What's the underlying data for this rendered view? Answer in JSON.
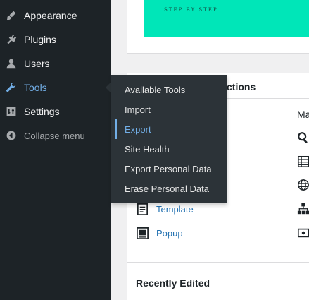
{
  "sidebar": {
    "items": [
      {
        "label": "Appearance",
        "icon": "paintbrush-icon"
      },
      {
        "label": "Plugins",
        "icon": "plugin-icon"
      },
      {
        "label": "Users",
        "icon": "user-icon"
      },
      {
        "label": "Tools",
        "icon": "wrench-icon"
      },
      {
        "label": "Settings",
        "icon": "settings-icon"
      }
    ],
    "collapse_label": "Collapse menu"
  },
  "tools_flyout": {
    "items": [
      "Available Tools",
      "Import",
      "Export",
      "Site Health",
      "Export Personal Data",
      "Erase Personal Data"
    ],
    "current": "Export"
  },
  "content": {
    "banner_text": "STEP BY STEP",
    "section_title_visible": "ctions",
    "right_column_label": "Ma",
    "links": [
      "Template",
      "Popup"
    ],
    "recently_edited_title": "Recently Edited"
  },
  "colors": {
    "sidebar_bg": "#1d2327",
    "flyout_bg": "#2c3338",
    "accent": "#72aee6",
    "link": "#2271b1",
    "banner": "#00e6b8"
  }
}
